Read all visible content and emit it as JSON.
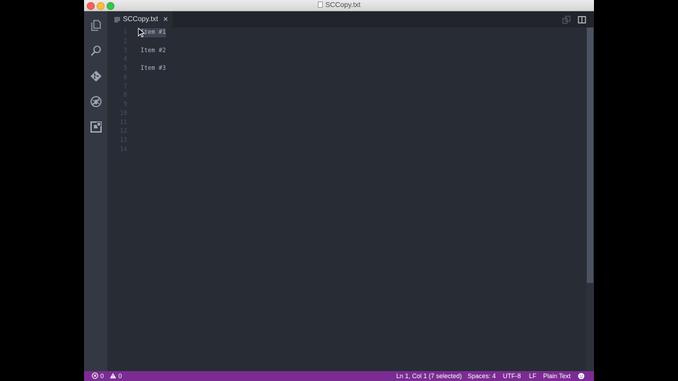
{
  "window": {
    "title": "SCCopy.txt"
  },
  "activity_bar": {
    "icons": [
      "explorer-icon",
      "search-icon",
      "git-icon",
      "debug-icon",
      "extensions-icon"
    ]
  },
  "tab": {
    "label": "SCCopy.txt",
    "close_symbol": "×"
  },
  "editor": {
    "lines": [
      {
        "number": "1",
        "text": "Item #1"
      },
      {
        "number": "2",
        "text": ""
      },
      {
        "number": "3",
        "text": "Item #2"
      },
      {
        "number": "4",
        "text": ""
      },
      {
        "number": "5",
        "text": "Item #3"
      },
      {
        "number": "6",
        "text": ""
      },
      {
        "number": "7",
        "text": ""
      },
      {
        "number": "8",
        "text": ""
      },
      {
        "number": "9",
        "text": ""
      },
      {
        "number": "10",
        "text": ""
      },
      {
        "number": "11",
        "text": ""
      },
      {
        "number": "12",
        "text": ""
      },
      {
        "number": "13",
        "text": ""
      },
      {
        "number": "14",
        "text": ""
      }
    ]
  },
  "status_bar": {
    "errors": "0",
    "warnings": "0",
    "position": "Ln 1, Col 1 (7 selected)",
    "indentation": "Spaces: 4",
    "encoding": "UTF-8",
    "eol": "LF",
    "language": "Plain Text"
  },
  "colors": {
    "accent": "#7b2c93",
    "editor_bg": "#282c34",
    "selection": "#3e4451"
  }
}
